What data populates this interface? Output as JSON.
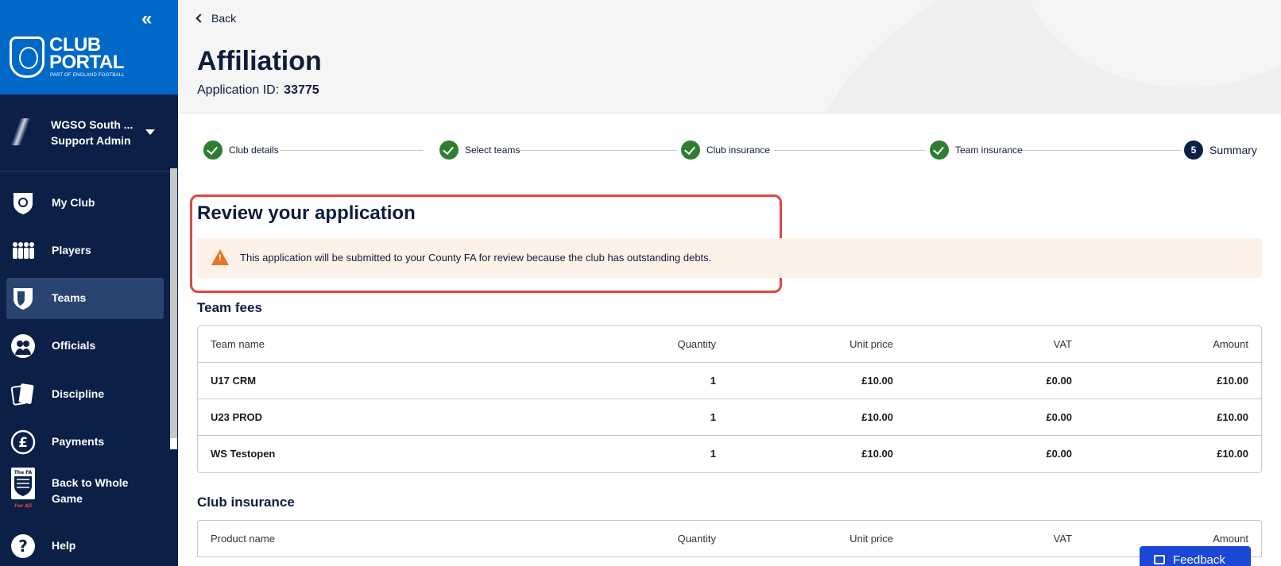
{
  "sidebar": {
    "collapse_icon": "«",
    "brand": {
      "title_line1": "CLUB",
      "title_line2": "PORTAL",
      "subtitle": "PART OF ENGLAND FOOTBALL"
    },
    "account": {
      "name": "WGSO South ...",
      "role": "Support Admin"
    },
    "items": [
      {
        "label": "My Club",
        "icon": "club-shield-icon"
      },
      {
        "label": "Players",
        "icon": "players-icon"
      },
      {
        "label": "Teams",
        "icon": "teams-shield-icon",
        "active": true
      },
      {
        "label": "Officials",
        "icon": "officials-icon"
      },
      {
        "label": "Discipline",
        "icon": "cards-icon"
      },
      {
        "label": "Payments",
        "icon": "pound-icon"
      },
      {
        "label": "Back to Whole Game",
        "icon": "fa-crest-icon",
        "icon_text": "The FA",
        "icon_tag": "For All"
      },
      {
        "label": "Help",
        "icon": "help-icon"
      }
    ]
  },
  "header": {
    "back_label": "Back",
    "title": "Affiliation",
    "app_id_label": "Application ID:",
    "app_id_value": "33775"
  },
  "stepper": {
    "steps": [
      {
        "label": "Club details",
        "status": "done"
      },
      {
        "label": "Select teams",
        "status": "done"
      },
      {
        "label": "Club insurance",
        "status": "done"
      },
      {
        "label": "Team insurance",
        "status": "done"
      },
      {
        "label": "Summary",
        "number": "5",
        "status": "current"
      }
    ]
  },
  "review": {
    "title": "Review your application",
    "alert_text": "This application will be submitted to your County FA for review because the club has outstanding debts."
  },
  "team_fees": {
    "title": "Team fees",
    "headers": [
      "Team name",
      "Quantity",
      "Unit price",
      "VAT",
      "Amount"
    ],
    "rows": [
      [
        "U17 CRM",
        "1",
        "£10.00",
        "£0.00",
        "£10.00"
      ],
      [
        "U23 PROD",
        "1",
        "£10.00",
        "£0.00",
        "£10.00"
      ],
      [
        "WS Testopen",
        "1",
        "£10.00",
        "£0.00",
        "£10.00"
      ]
    ]
  },
  "club_insurance": {
    "title": "Club insurance",
    "headers": [
      "Product name",
      "Quantity",
      "Unit price",
      "VAT",
      "Amount"
    ]
  },
  "feedback_label": "Feedback",
  "colors": {
    "sidebar_bg": "#0b1f47",
    "brand_bg": "#0069c8",
    "active_nav": "#2a4470",
    "done_step": "#2e7d32",
    "highlight_border": "#e0473e",
    "alert_bg": "#fdf1e8",
    "warning_icon": "#e8741f",
    "feedback_bg": "#1b47d6"
  }
}
